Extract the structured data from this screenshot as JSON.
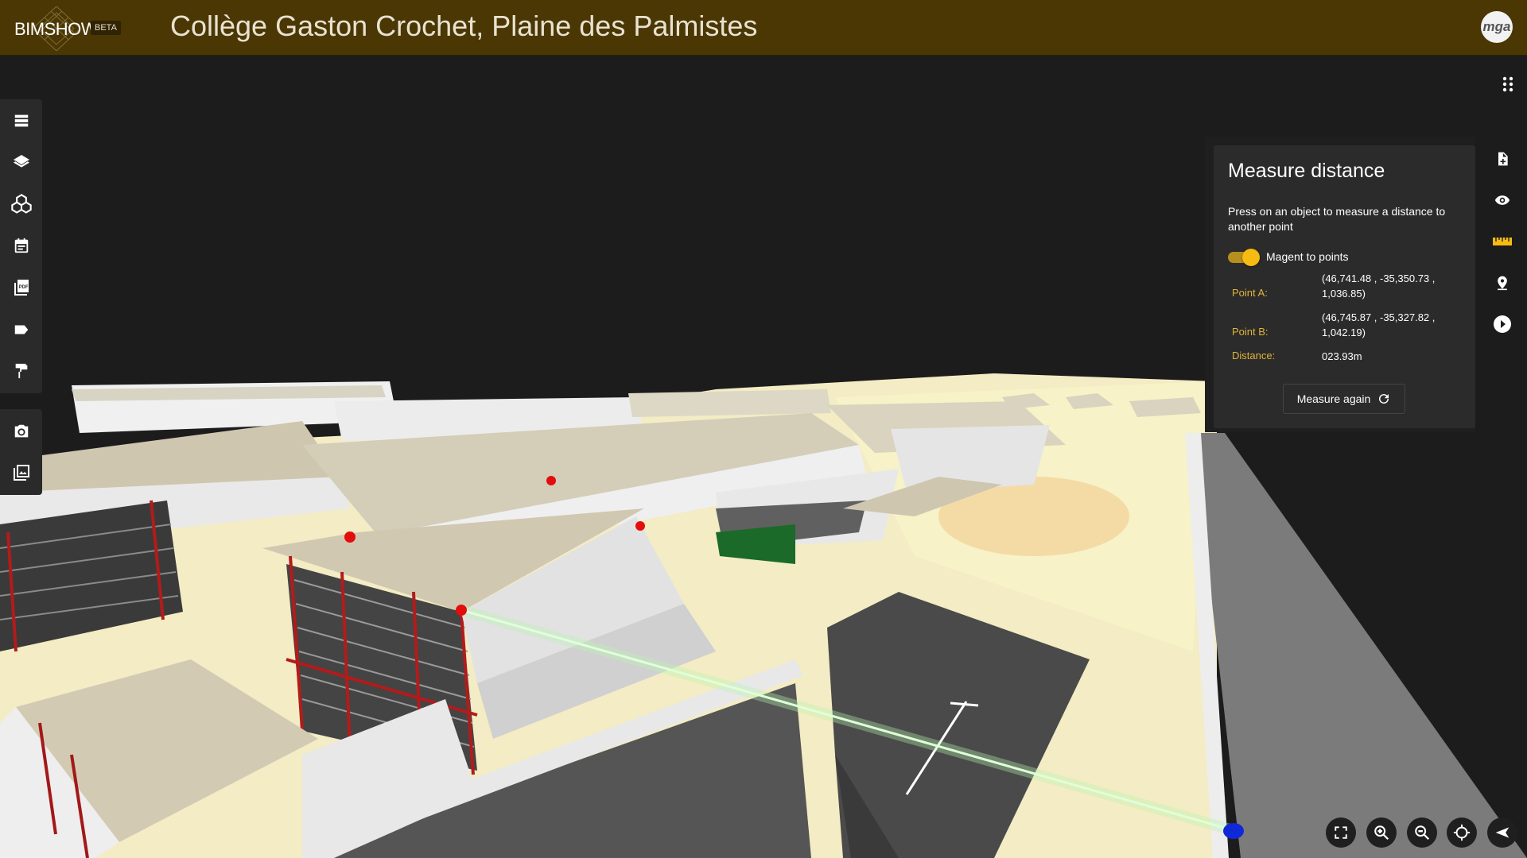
{
  "app": {
    "logo_text": "BIMSHOW",
    "logo_badge": "BETA",
    "title": "Collège Gaston Crochet, Plaine des Palmistes",
    "user_avatar": "mga"
  },
  "colors": {
    "topbar": "#4a3704",
    "accent": "#f6bb12",
    "panel": "#2b2b2b",
    "label": "#e0b43a"
  },
  "left_toolbar": [
    {
      "icon": "list-icon"
    },
    {
      "icon": "layers-icon"
    },
    {
      "icon": "cubes-icon"
    },
    {
      "icon": "calendar-icon"
    },
    {
      "icon": "pdf-icon"
    },
    {
      "icon": "label-icon"
    },
    {
      "icon": "paint-roller-icon"
    }
  ],
  "left_toolbar_2": [
    {
      "icon": "camera-icon"
    },
    {
      "icon": "gallery-icon"
    }
  ],
  "right_toolbar": [
    {
      "icon": "add-document-icon"
    },
    {
      "icon": "eye-icon"
    },
    {
      "icon": "ruler-icon",
      "active": true
    },
    {
      "icon": "location-pin-icon"
    },
    {
      "icon": "play-icon"
    }
  ],
  "measure": {
    "title": "Measure distance",
    "description": "Press on an object to measure a distance to another point",
    "toggle_label": "Magent to points",
    "toggle_on": true,
    "point_a_label": "Point A:",
    "point_a_value": "(46,741.48 , -35,350.73 , 1,036.85)",
    "point_b_label": "Point B:",
    "point_b_value": "(46,745.87 , -35,327.82 , 1,042.19)",
    "distance_label": "Distance:",
    "distance_value": "023.93m",
    "button_label": "Measure again"
  },
  "bottom_controls": [
    {
      "icon": "fullscreen-icon"
    },
    {
      "icon": "zoom-in-icon"
    },
    {
      "icon": "zoom-out-icon"
    },
    {
      "icon": "crosshair-icon"
    },
    {
      "icon": "collapse-arrow-icon"
    }
  ]
}
